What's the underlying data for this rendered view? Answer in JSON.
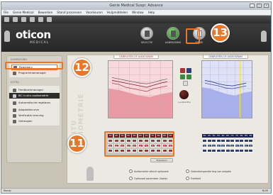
{
  "window": {
    "title": "Genie Medical Suspr. Advance",
    "controls": [
      "_",
      "□",
      "×"
    ]
  },
  "menu": [
    "File",
    "Genie Medical",
    "Bewerken",
    "Stand processen",
    "Voorkeuren",
    "Hulpmiddelen",
    "Window",
    "Help"
  ],
  "brand": {
    "name": "oticon",
    "subtitle": "MEDICAL"
  },
  "steps": [
    {
      "label": "SELECTIE",
      "icon": "device-icon",
      "active": false
    },
    {
      "label": "AANPASSING",
      "icon": "fitting-icon",
      "active": true
    },
    {
      "label": "EINDE",
      "icon": "end-icon",
      "active": false
    }
  ],
  "callouts": {
    "c11": "11",
    "c12": "12",
    "c13": "13"
  },
  "sidebar": {
    "section1_title": "AANPASSING",
    "item_selected": "Regelaars",
    "item2": "Programmamanager",
    "section2_title": "EXTRA",
    "extra_items": [
      "Feedbackmanager",
      "BC in-situ audiometrie",
      "Automatische regelaars",
      "Adaptatiecurve",
      "Verificatie lemning",
      "Geheugen"
    ]
  },
  "main": {
    "vertical_label": "IN SITU AUDIOMETRIE",
    "left_graph_title": "GEBRUITEN OF AUDIOGRAM",
    "right_graph_title": "GEBRUITEN OF AUDIOGRAM",
    "knob_label": "Lautsterkte",
    "table_rows": [
      "40",
      "45",
      "50",
      "55",
      "60",
      "65",
      "70",
      "75",
      "80",
      "85",
      "90"
    ],
    "left_row_values": [
      "35",
      "40",
      "45",
      "50",
      "45",
      "40",
      "35",
      "35",
      "40",
      "35",
      "30"
    ],
    "right_row_values": [
      "30",
      "35",
      "40",
      "45",
      "45",
      "40",
      "30",
      "35",
      "40",
      "30",
      "25"
    ],
    "apply_button": "Toepassen",
    "options": [
      "Audiometrie stimuli optionele",
      "Gebruikerspositie ting van adaptie",
      "Optionaal parameter (Vaste)",
      "Freefield"
    ]
  },
  "colors": {
    "accent_orange": "#e8772a",
    "left_graph_bg": "#f7d9dc",
    "left_graph_fill": "#e99aa4",
    "right_graph_bg": "#dfe2f7",
    "right_graph_fill": "#a7b0ea",
    "left_table": "#a33438",
    "right_table": "#2d3e7a"
  },
  "status": {
    "left": "Ready",
    "right": "NUM"
  }
}
